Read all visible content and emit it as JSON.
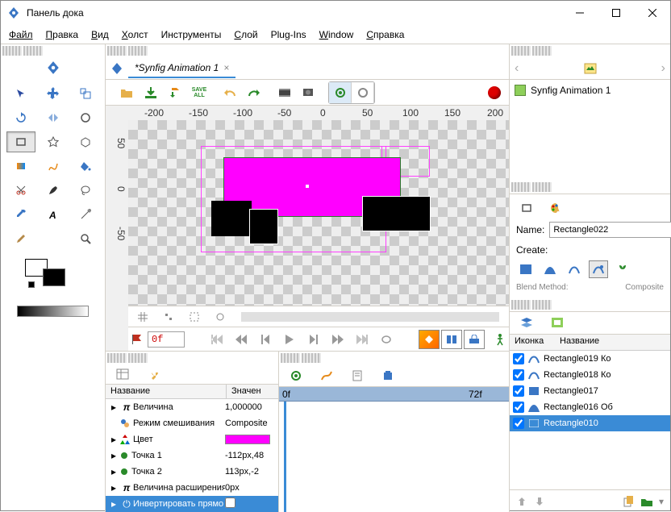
{
  "window": {
    "title": "Панель дока"
  },
  "menu": {
    "file": "Файл",
    "edit": "Правка",
    "view": "Вид",
    "canvas": "Холст",
    "tools": "Инструменты",
    "layer": "Слой",
    "plugins": "Plug-Ins",
    "window": "Window",
    "help": "Справка"
  },
  "doc_tab": {
    "title": "*Synfig Animation 1"
  },
  "nav_doc": {
    "title": "Synfig Animation 1"
  },
  "ruler_h": {
    "t_m200": "-200",
    "t_m150": "-150",
    "t_m100": "-100",
    "t_m50": "-50",
    "t_0": "0",
    "t_50": "50",
    "t_100": "100",
    "t_150": "150",
    "t_200": "200"
  },
  "ruler_v": {
    "t_m50": "-50",
    "t_0": "0",
    "t_50": "50"
  },
  "toolbar": {
    "save_all": "SAVE ALL"
  },
  "playback": {
    "frame": "0f"
  },
  "params": {
    "head_name": "Название",
    "head_value": "Значен",
    "rows": [
      {
        "icon": "π",
        "name": "Величина",
        "value": "1,000000"
      },
      {
        "icon": "mix",
        "name": "Режим смешивания",
        "value": "Composite"
      },
      {
        "icon": "rgb",
        "name": "Цвет",
        "value": ""
      },
      {
        "icon": "pt",
        "name": "Точка 1",
        "value": "-112px,48"
      },
      {
        "icon": "pt",
        "name": "Точка 2",
        "value": "113px,-2"
      },
      {
        "icon": "π",
        "name": "Величина расширения",
        "value": "0px"
      },
      {
        "icon": "pwr",
        "name": "Инвертировать прямо",
        "value": ""
      }
    ]
  },
  "timeline": {
    "start": "0f",
    "mid": "72f"
  },
  "toolopts": {
    "name_label": "Name:",
    "name_value": "Rectangle022",
    "create_label": "Create:",
    "blend_label": "Blend Method:",
    "blend_value": "Composite"
  },
  "layers": {
    "head_icon": "Иконка",
    "head_name": "Название",
    "rows": [
      {
        "name": "Rectangle019 Ко",
        "type": "outline"
      },
      {
        "name": "Rectangle018 Ко",
        "type": "outline"
      },
      {
        "name": "Rectangle017",
        "type": "rect"
      },
      {
        "name": "Rectangle016 Об",
        "type": "region"
      },
      {
        "name": "Rectangle010",
        "type": "rect",
        "sel": true
      }
    ]
  }
}
